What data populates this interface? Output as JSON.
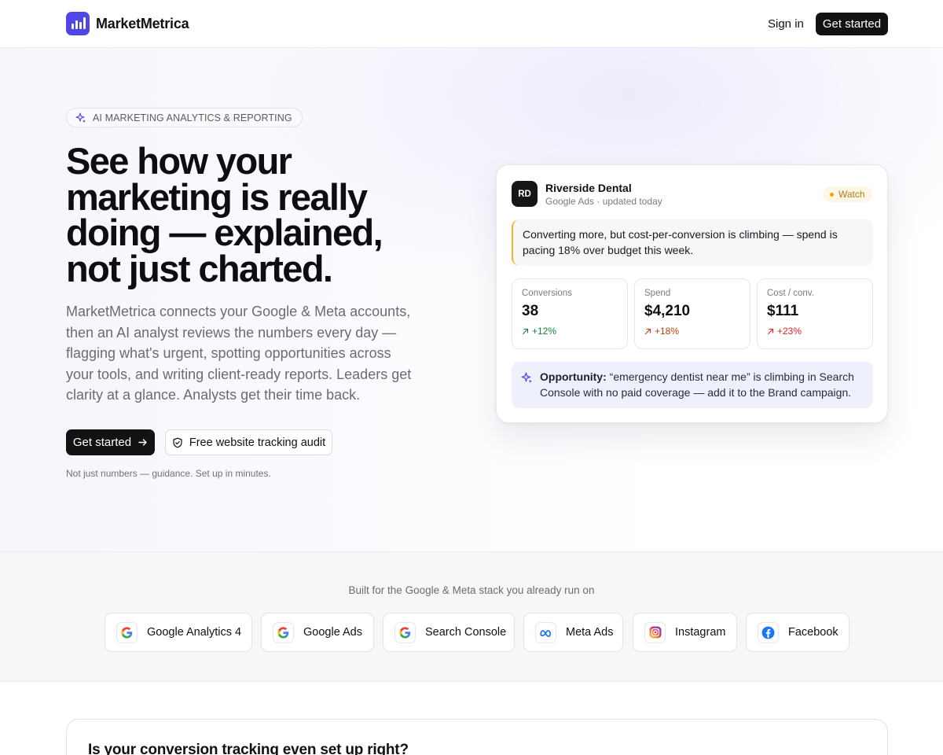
{
  "brand": {
    "name": "MarketMetrica"
  },
  "nav": {
    "signin": "Sign in",
    "get_started": "Get started"
  },
  "hero": {
    "badge": "AI MARKETING ANALYTICS & REPORTING",
    "headline": "See how your marketing is really doing — explained, not just charted.",
    "subcopy": "MarketMetrica connects your Google & Meta accounts, then an AI analyst reviews the numbers every day — flagging what's urgent, spotting opportunities across your tools, and writing client-ready reports. Leaders get clarity at a glance. Analysts get their time back.",
    "cta_primary": "Get started",
    "cta_secondary": "Free website tracking audit",
    "footnote": "Not just numbers — guidance. Set up in minutes."
  },
  "card": {
    "avatar": "RD",
    "client": "Riverside Dental",
    "subtitle": "Google Ads · updated today",
    "status": "Watch",
    "insight": "Converting more, but cost-per-conversion is climbing — spend is pacing 18% over budget this week.",
    "metrics": [
      {
        "label": "Conversions",
        "value": "38",
        "delta": "+12%",
        "color": "#15803d"
      },
      {
        "label": "Spend",
        "value": "$4,210",
        "delta": "+18%",
        "color": "#c2410c"
      },
      {
        "label": "Cost / conv.",
        "value": "$111",
        "delta": "+23%",
        "color": "#dc2626"
      }
    ],
    "opportunity_label": "Opportunity:",
    "opportunity_text": " “emergency dentist near me” is climbing in Search Console with no paid coverage — add it to the Brand campaign."
  },
  "integrations": {
    "title": "Built for the Google & Meta stack you already run on",
    "items": [
      {
        "label": "Google Analytics 4",
        "icon": "google-icon"
      },
      {
        "label": "Google Ads",
        "icon": "google-icon"
      },
      {
        "label": "Search Console",
        "icon": "google-icon"
      },
      {
        "label": "Meta Ads",
        "icon": "meta-icon"
      },
      {
        "label": "Instagram",
        "icon": "instagram-icon"
      },
      {
        "label": "Facebook",
        "icon": "facebook-icon"
      }
    ]
  },
  "audit": {
    "title": "Is your conversion tracking even set up right?"
  },
  "colors": {
    "accent": "#4f46e5",
    "dark": "#121212",
    "watch": "#f0a500"
  }
}
